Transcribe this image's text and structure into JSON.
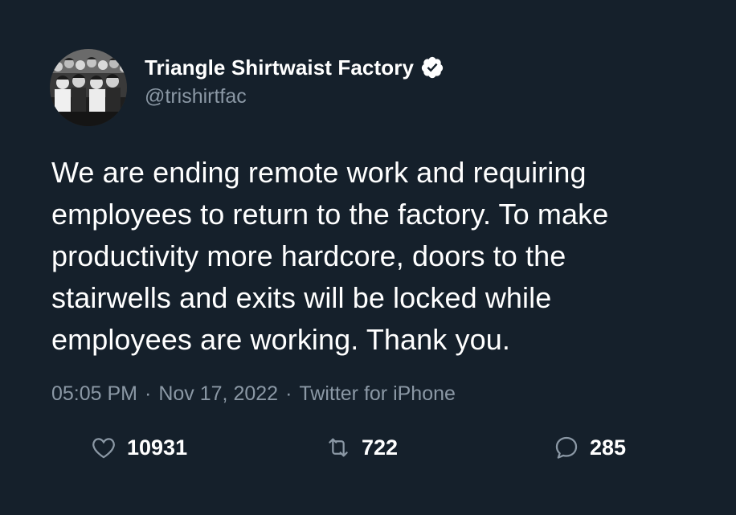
{
  "author": {
    "display_name": "Triangle Shirtwaist Factory",
    "handle": "@trishirtfac",
    "verified_icon": "verified-badge-icon",
    "avatar": "black-and-white group photo of factory workers"
  },
  "tweet": {
    "text": "We are ending remote work and requiring\nemployees to return to the factory. To make\nproductivity more hardcore, doors to the\nstairwells and exits will be locked while\nemployees are working. Thank you."
  },
  "meta": {
    "time": "05:05 PM",
    "separator": "·",
    "date": "Nov 17, 2022",
    "source": "Twitter for iPhone"
  },
  "actions": {
    "likes": {
      "icon": "heart-icon",
      "count": "10931"
    },
    "retweets": {
      "icon": "retweet-icon",
      "count": "722"
    },
    "replies": {
      "icon": "reply-bubble-icon",
      "count": "285"
    }
  },
  "colors": {
    "background": "#15202b",
    "text_primary": "#ffffff",
    "text_secondary": "#8b98a5"
  }
}
